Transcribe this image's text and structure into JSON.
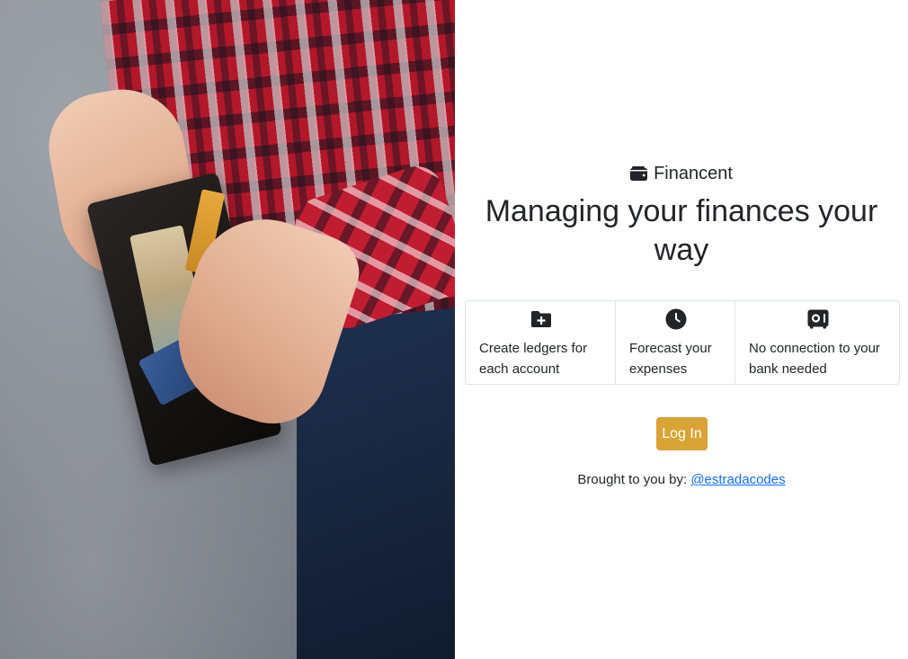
{
  "hero_image": {
    "icon": "wallet-photo"
  },
  "brand": {
    "icon": "wallet-icon",
    "name": "Financent"
  },
  "headline": "Managing your finances your way",
  "features": [
    {
      "icon": "folder-plus-icon",
      "text": "Create ledgers for each account"
    },
    {
      "icon": "clock-icon",
      "text": "Forecast your expenses"
    },
    {
      "icon": "safe-icon",
      "text": "No connection to your bank needed"
    }
  ],
  "login_button": {
    "label": "Log In",
    "color": "#d9a335"
  },
  "credit": {
    "prefix": "Brought to you by:",
    "link_text": "@estradacodes",
    "link_color": "#0d6efd"
  }
}
